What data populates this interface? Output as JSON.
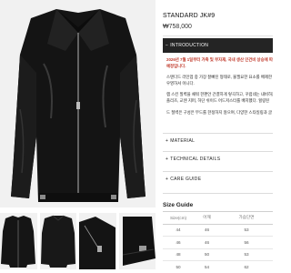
{
  "product": {
    "title": "STANDARD JK#9",
    "price": "₩758,000"
  },
  "introduction": {
    "label": "INTRODUCTION",
    "icon": "minus-icon",
    "highlight_lines": [
      "2026년 7월 1일부터 가죽 및 부자재, 국내 생산 인건비 상승에 따",
      "예정입니다."
    ],
    "body_paragraph_1": [
      "스탠다드 라인업 중 가장 잘빠진 형태로, 불필요한 요소를 배제한",
      "우영하셔 이니다."
    ],
    "body_paragraph_2": [
      "램 스킨 질벽을 채워 한편안 간결하게 렇곡하고, 꾸럽네는 내비하는",
      "플리즈, 교텐 지퍼, 하단 쉬이드 어드저스터를 배치했다. 힐링된",
      "",
      "드 질벽은 구성은 무드를 한정하지 않으며, 다양한 스타일링과 글"
    ]
  },
  "accordion": [
    {
      "label": "MATERIAL",
      "icon": "plus-icon"
    },
    {
      "label": "TECHNICAL DETAILS",
      "icon": "plus-icon"
    },
    {
      "label": "CARE GUIDE",
      "icon": "plus-icon"
    }
  ],
  "size_guide": {
    "title": "Size Guide",
    "headers": [
      "Size(cm)",
      "어깨",
      "가슴단면"
    ],
    "rows": [
      [
        "44",
        "46",
        "53"
      ],
      [
        "46",
        "46",
        "56"
      ],
      [
        "48",
        "50",
        "53"
      ],
      [
        "50",
        "54",
        "62"
      ]
    ]
  },
  "colors": {
    "intro_bar_bg": "#242424",
    "highlight_text": "#c0392b",
    "image_bg": "#f1f1f1",
    "leather": "#141414"
  }
}
